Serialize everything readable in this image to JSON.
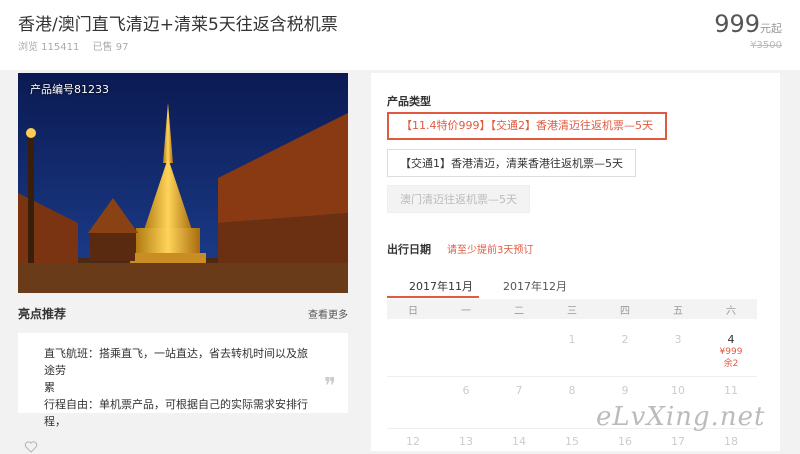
{
  "header": {
    "title": "香港/澳门直飞清迈+清莱5天往返含税机票",
    "views": "浏览 115411",
    "sold": "已售 97",
    "price": "999",
    "price_unit": "元起",
    "orig_price": "¥3500"
  },
  "photo": {
    "code": "产品编号81233"
  },
  "highlights": {
    "title": "亮点推荐",
    "more": "查看更多",
    "lines": [
      "直飞航班：搭乘直飞，一站直达，省去转机时间以及旅途劳",
      "累",
      "行程自由：单机票产品，可根据自己的实际需求安排行程，"
    ]
  },
  "booking": {
    "type_label": "产品类型",
    "options": [
      "【11.4特价999】【交通2】香港清迈往返机票—5天",
      "【交通1】香港清迈，清莱香港往返机票—5天",
      "澳门清迈往返机票—5天"
    ],
    "date_label": "出行日期",
    "date_hint": "请至少提前3天预订",
    "months": [
      "2017年11月",
      "2017年12月"
    ],
    "weekdays": [
      "日",
      "一",
      "二",
      "三",
      "四",
      "五",
      "六"
    ],
    "row1": [
      "1",
      "2",
      "3",
      "4"
    ],
    "day4_price": "¥999",
    "day4_left": "余2",
    "row2": [
      "6",
      "7",
      "8",
      "9",
      "10",
      "11"
    ],
    "row3": [
      "12",
      "13",
      "14",
      "15",
      "16",
      "17",
      "18"
    ]
  },
  "watermark": "eLvXing.net",
  "colors": {
    "accent": "#e05a40"
  }
}
